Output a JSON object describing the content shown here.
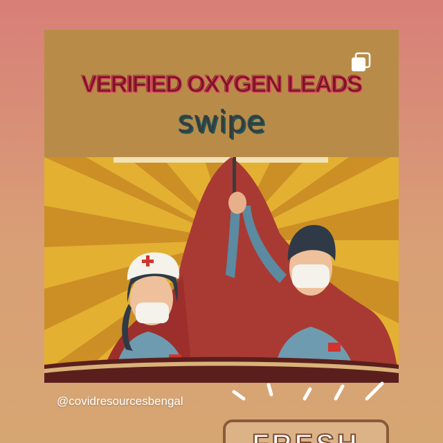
{
  "post": {
    "headline": "VERIFIED OXYGEN LEADS",
    "subheadline": "swipe",
    "illustration_icon": "frontline-workers-poster-illustration",
    "multi_image_icon": "multiple-images-icon"
  },
  "caption": {
    "handle": "@covidresourcesbengal"
  },
  "sticker": {
    "label": "FRESH"
  },
  "colors": {
    "background_top": "#d87f78",
    "background_bottom": "#d6a672",
    "card": "#b88c48",
    "headline_text": "#7a1624",
    "swipe_text": "#3a3a3a",
    "handle_text": "#ffffff"
  }
}
